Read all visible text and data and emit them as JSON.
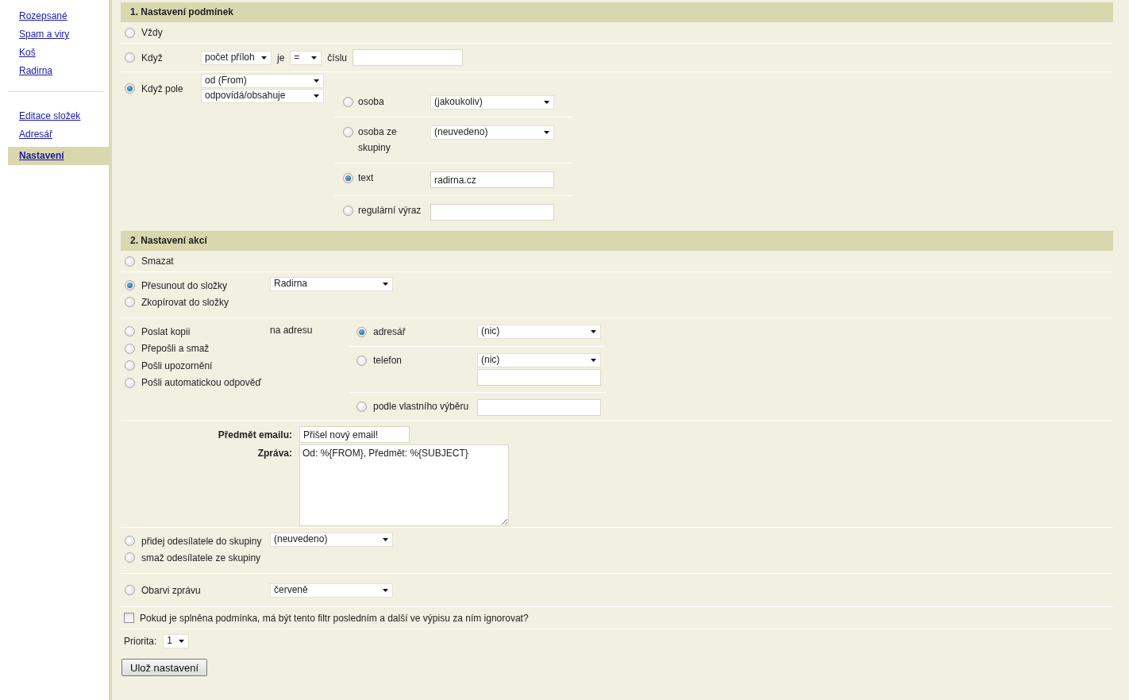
{
  "sidebar": {
    "items": [
      {
        "label": "Rozepsané",
        "selected": false
      },
      {
        "label": "Spam a viry",
        "selected": false
      },
      {
        "label": "Koš",
        "selected": false
      },
      {
        "label": "Radirna",
        "selected": false
      }
    ],
    "items_2": [
      {
        "label": "Editace složek",
        "selected": false
      },
      {
        "label": "Adresář",
        "selected": false
      },
      {
        "label": "Nastavení",
        "selected": true
      }
    ]
  },
  "conditions": {
    "title": "1. Nastavení podmínek",
    "always": {
      "label": "Vždy",
      "selected": false
    },
    "attachments": {
      "label": "Když",
      "selected": false,
      "field": "počet příloh",
      "is_label": "je",
      "operator": "=",
      "number_label": "číslu"
    },
    "field_rule": {
      "label": "Když pole",
      "selected": true,
      "field": "od (From)",
      "match": "odpovídá/obsahuje",
      "options": [
        {
          "kind": "select",
          "label": "osoba",
          "selected": false,
          "value": "(jakoukoliv)"
        },
        {
          "kind": "select",
          "label": "osoba ze skupiny",
          "selected": false,
          "value": "(neuvedeno)"
        },
        {
          "kind": "input",
          "label": "text",
          "selected": true,
          "value": "radirna.cz"
        },
        {
          "kind": "input",
          "label": "regulární výraz",
          "selected": false
        }
      ]
    }
  },
  "actions": {
    "title": "2. Nastavení akcí",
    "delete": {
      "label": "Smazat",
      "selected": false
    },
    "folder": {
      "options": [
        {
          "label": "Přesunout do složky",
          "selected": true
        },
        {
          "label": "Zkopírovat do složky",
          "selected": false
        }
      ],
      "folder": "Radirna"
    },
    "send": {
      "options": [
        {
          "label": "Poslat kopii",
          "selected": false
        },
        {
          "label": "Přepošli a smaž",
          "selected": false
        },
        {
          "label": "Pošli upozornění",
          "selected": false
        },
        {
          "label": "Pošli automatickou odpověď",
          "selected": false
        }
      ],
      "address_label": "na adresu",
      "targets": [
        {
          "kind": "select",
          "label": "adresář",
          "selected": true,
          "value": "(nic)"
        },
        {
          "kind": "select_input",
          "label": "telefon",
          "selected": false,
          "value": "(nic)"
        },
        {
          "kind": "input",
          "label": "podle vlastního výběru",
          "selected": false
        }
      ]
    },
    "subject_label": "Předmět emailu:",
    "subject": "Přišel nový email!",
    "message_label": "Zpráva:",
    "message": "Od: %{FROM}, Předmět: %{SUBJECT}",
    "group": {
      "options": [
        {
          "label": "přidej odesílatele do skupiny",
          "selected": false
        },
        {
          "label": "smaž odesílatele ze skupiny",
          "selected": false
        }
      ],
      "group": "(neuvedeno)"
    },
    "color": {
      "label": "Obarvi zprávu",
      "selected": false,
      "value": "červeně"
    },
    "stop": {
      "label": "Pokud je splněna podmínka, má být tento filtr posledním a další ve výpisu za ním ignorovat?",
      "checked": false
    },
    "priority": {
      "label": "Priorita:",
      "value": "1"
    },
    "save": "Ulož nastavení"
  }
}
